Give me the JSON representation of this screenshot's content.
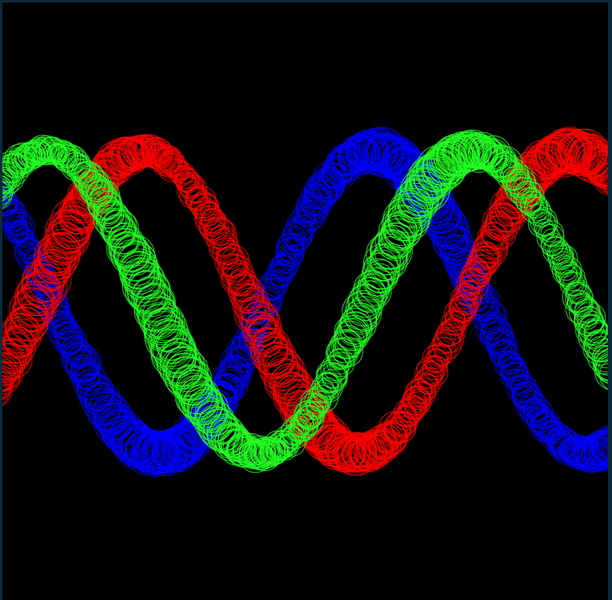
{
  "scene": {
    "background": "#000000",
    "frame_color": "#0d2a3a",
    "strands": [
      {
        "name": "red",
        "color": "#ff0000"
      },
      {
        "name": "green",
        "color": "#22ff22"
      },
      {
        "name": "blue",
        "color": "#0000ff"
      }
    ]
  }
}
